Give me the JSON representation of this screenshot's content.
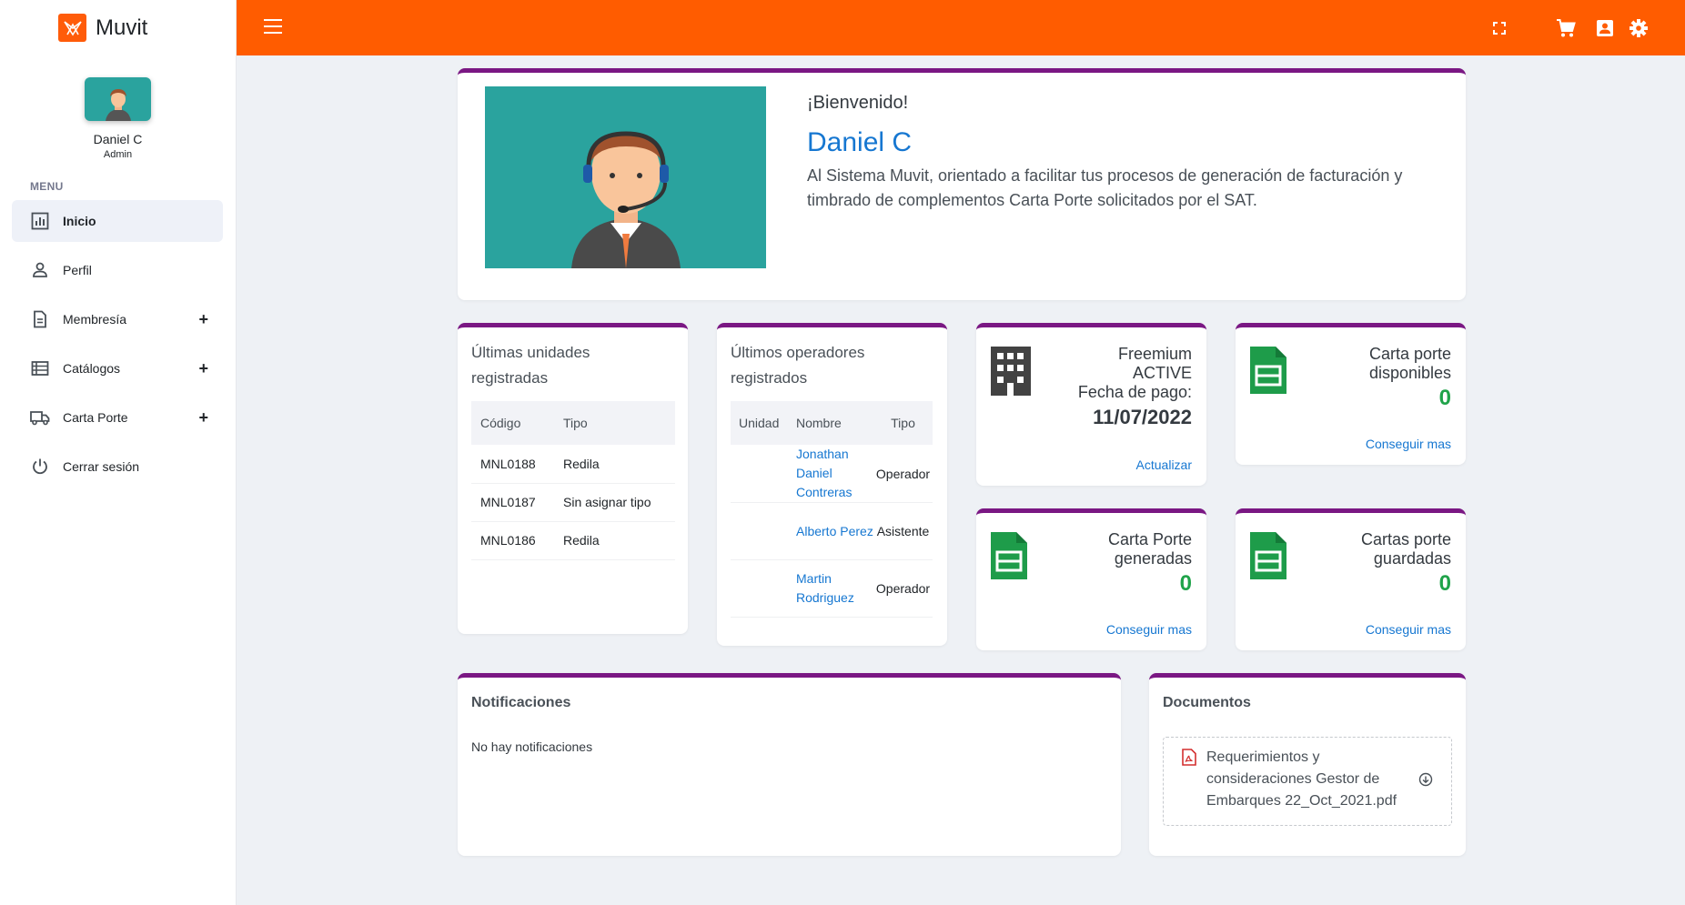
{
  "app": {
    "name": "Muvit"
  },
  "user": {
    "name": "Daniel C",
    "role": "Admin"
  },
  "sidebar": {
    "menu_title": "MENU",
    "items": [
      {
        "label": "Inicio",
        "icon": "chart-icon",
        "active": true,
        "expandable": false
      },
      {
        "label": "Perfil",
        "icon": "user-icon",
        "active": false,
        "expandable": false
      },
      {
        "label": "Membresía",
        "icon": "document-icon",
        "active": false,
        "expandable": true
      },
      {
        "label": "Catálogos",
        "icon": "list-icon",
        "active": false,
        "expandable": true
      },
      {
        "label": "Carta Porte",
        "icon": "truck-icon",
        "active": false,
        "expandable": true
      },
      {
        "label": "Cerrar sesión",
        "icon": "power-icon",
        "active": false,
        "expandable": false
      }
    ],
    "plus_symbol": "+"
  },
  "topbar": {
    "icons": [
      "menu-icon",
      "fullscreen-icon",
      "cart-icon",
      "contact-icon",
      "gear-icon"
    ]
  },
  "welcome": {
    "greeting": "¡Bienvenido!",
    "name": "Daniel C",
    "text": "Al Sistema Muvit, orientado a facilitar tus procesos de generación de facturación y timbrado de complementos Carta Porte solicitados por el SAT."
  },
  "units": {
    "title": "Últimas unidades registradas",
    "columns": [
      "Código",
      "Tipo"
    ],
    "rows": [
      {
        "code": "MNL0188",
        "type": "Redila"
      },
      {
        "code": "MNL0187",
        "type": "Sin asignar tipo"
      },
      {
        "code": "MNL0186",
        "type": "Redila"
      }
    ]
  },
  "operators": {
    "title": "Últimos operadores registrados",
    "columns": [
      "Unidad",
      "Nombre",
      "Tipo"
    ],
    "rows": [
      {
        "unit": "",
        "name": "Jonathan Daniel Contreras",
        "type": "Operador"
      },
      {
        "unit": "",
        "name": "Alberto Perez",
        "type": "Asistente"
      },
      {
        "unit": "",
        "name": "Martin Rodriguez",
        "type": "Operador"
      }
    ]
  },
  "membership": {
    "plan": "Freemium",
    "status": "ACTIVE",
    "date_label": "Fecha de pago:",
    "date": "11/07/2022",
    "action": "Actualizar"
  },
  "stats": {
    "available": {
      "label_1": "Carta porte",
      "label_2": "disponibles",
      "value": "0",
      "action": "Conseguir mas"
    },
    "generated": {
      "label_1": "Carta Porte",
      "label_2": "generadas",
      "value": "0",
      "action": "Conseguir mas"
    },
    "saved": {
      "label_1": "Cartas porte",
      "label_2": "guardadas",
      "value": "0",
      "action": "Conseguir mas"
    }
  },
  "notifications": {
    "title": "Notificaciones",
    "empty": "No hay notificaciones"
  },
  "documents": {
    "title": "Documentos",
    "items": [
      {
        "name": "Requerimientos y consideraciones Gestor de Embarques 22_Oct_2021.pdf"
      }
    ]
  },
  "colors": {
    "accent": "#ff5c00",
    "card_border": "#7a1783",
    "link": "#1677d1",
    "value": "#20a34a",
    "avatar_bg": "#2aa39e"
  }
}
